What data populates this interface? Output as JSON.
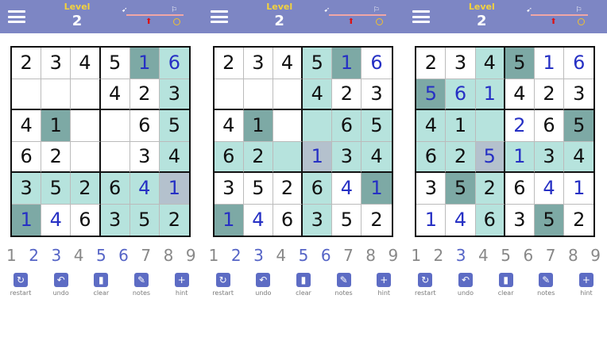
{
  "header": {
    "level_label": "Level",
    "level_value": "2",
    "progress_start_icon": "rocket-start-icon",
    "progress_end_icon": "finish-flag-icon",
    "progress_marker_icon": "arrow-up-icon",
    "reward_icon": "coin-icon"
  },
  "colors": {
    "header_bg": "#7d86c4",
    "level_label": "#f3d23d",
    "user_digit": "#2630c4",
    "highlight": "#b6e3dd",
    "selected_dark": "#7da9a5",
    "selected_gray": "#b4c1cd"
  },
  "numpad": [
    "1",
    "2",
    "3",
    "4",
    "5",
    "6",
    "7",
    "8",
    "9"
  ],
  "tools": [
    {
      "label": "restart",
      "icon": "restart-icon"
    },
    {
      "label": "undo",
      "icon": "undo-icon"
    },
    {
      "label": "clear",
      "icon": "trash-icon"
    },
    {
      "label": "notes",
      "icon": "pencil-icon"
    },
    {
      "label": "hint",
      "icon": "plus-icon"
    }
  ],
  "screens": [
    {
      "highlighted_digits": [
        "2",
        "3",
        "5",
        "6"
      ],
      "grid": [
        [
          [
            "2",
            "g",
            ""
          ],
          [
            "3",
            "g",
            ""
          ],
          [
            "4",
            "g",
            ""
          ],
          [
            "5",
            "g",
            ""
          ],
          [
            "1",
            "u",
            "d"
          ],
          [
            "6",
            "u",
            "h"
          ]
        ],
        [
          [
            "",
            "g",
            ""
          ],
          [
            "",
            "g",
            ""
          ],
          [
            "",
            "g",
            ""
          ],
          [
            "4",
            "g",
            ""
          ],
          [
            "2",
            "g",
            ""
          ],
          [
            "3",
            "g",
            "h"
          ]
        ],
        [
          [
            "4",
            "g",
            ""
          ],
          [
            "1",
            "g",
            "d"
          ],
          [
            "",
            "g",
            ""
          ],
          [
            "",
            "g",
            ""
          ],
          [
            "6",
            "g",
            ""
          ],
          [
            "5",
            "g",
            "h"
          ]
        ],
        [
          [
            "6",
            "g",
            ""
          ],
          [
            "2",
            "g",
            ""
          ],
          [
            "",
            "g",
            ""
          ],
          [
            "",
            "g",
            ""
          ],
          [
            "3",
            "g",
            ""
          ],
          [
            "4",
            "g",
            "h"
          ]
        ],
        [
          [
            "3",
            "g",
            "h"
          ],
          [
            "5",
            "g",
            "h"
          ],
          [
            "2",
            "g",
            "h"
          ],
          [
            "6",
            "g",
            "h"
          ],
          [
            "4",
            "u",
            "h"
          ],
          [
            "1",
            "u",
            "s"
          ]
        ],
        [
          [
            "1",
            "u",
            "d"
          ],
          [
            "4",
            "u",
            ""
          ],
          [
            "6",
            "g",
            ""
          ],
          [
            "3",
            "g",
            "h"
          ],
          [
            "5",
            "g",
            "h"
          ],
          [
            "2",
            "g",
            "h"
          ]
        ]
      ]
    },
    {
      "highlighted_digits": [
        "2",
        "3",
        "5",
        "6"
      ],
      "grid": [
        [
          [
            "2",
            "g",
            ""
          ],
          [
            "3",
            "g",
            ""
          ],
          [
            "4",
            "g",
            ""
          ],
          [
            "5",
            "g",
            "h"
          ],
          [
            "1",
            "u",
            "d"
          ],
          [
            "6",
            "u",
            ""
          ]
        ],
        [
          [
            "",
            "g",
            ""
          ],
          [
            "",
            "g",
            ""
          ],
          [
            "",
            "g",
            ""
          ],
          [
            "4",
            "g",
            "h"
          ],
          [
            "2",
            "g",
            ""
          ],
          [
            "3",
            "g",
            ""
          ]
        ],
        [
          [
            "4",
            "g",
            ""
          ],
          [
            "1",
            "g",
            "d"
          ],
          [
            "",
            "g",
            ""
          ],
          [
            "",
            "g",
            "h"
          ],
          [
            "6",
            "g",
            "h"
          ],
          [
            "5",
            "g",
            "h"
          ]
        ],
        [
          [
            "6",
            "g",
            "h"
          ],
          [
            "2",
            "g",
            "h"
          ],
          [
            "",
            "g",
            "h"
          ],
          [
            "1",
            "u",
            "s"
          ],
          [
            "3",
            "g",
            "h"
          ],
          [
            "4",
            "g",
            "h"
          ]
        ],
        [
          [
            "3",
            "g",
            ""
          ],
          [
            "5",
            "g",
            ""
          ],
          [
            "2",
            "g",
            ""
          ],
          [
            "6",
            "g",
            "h"
          ],
          [
            "4",
            "u",
            ""
          ],
          [
            "1",
            "u",
            "d"
          ]
        ],
        [
          [
            "1",
            "u",
            "d"
          ],
          [
            "4",
            "u",
            ""
          ],
          [
            "6",
            "g",
            ""
          ],
          [
            "3",
            "g",
            "h"
          ],
          [
            "5",
            "g",
            ""
          ],
          [
            "2",
            "g",
            ""
          ]
        ]
      ]
    },
    {
      "highlighted_digits": [
        "3"
      ],
      "grid": [
        [
          [
            "2",
            "g",
            ""
          ],
          [
            "3",
            "g",
            ""
          ],
          [
            "4",
            "g",
            "h"
          ],
          [
            "5",
            "g",
            "d"
          ],
          [
            "1",
            "u",
            ""
          ],
          [
            "6",
            "u",
            ""
          ]
        ],
        [
          [
            "5",
            "u",
            "d"
          ],
          [
            "6",
            "u",
            "h"
          ],
          [
            "1",
            "u",
            "h"
          ],
          [
            "4",
            "g",
            ""
          ],
          [
            "2",
            "g",
            ""
          ],
          [
            "3",
            "g",
            ""
          ]
        ],
        [
          [
            "4",
            "g",
            "h"
          ],
          [
            "1",
            "g",
            "h"
          ],
          [
            "",
            "g",
            "h"
          ],
          [
            "2",
            "u",
            ""
          ],
          [
            "6",
            "g",
            ""
          ],
          [
            "5",
            "g",
            "d"
          ]
        ],
        [
          [
            "6",
            "g",
            "h"
          ],
          [
            "2",
            "g",
            "h"
          ],
          [
            "5",
            "u",
            "s"
          ],
          [
            "1",
            "u",
            "h"
          ],
          [
            "3",
            "g",
            "h"
          ],
          [
            "4",
            "g",
            "h"
          ]
        ],
        [
          [
            "3",
            "g",
            ""
          ],
          [
            "5",
            "g",
            "d"
          ],
          [
            "2",
            "g",
            "h"
          ],
          [
            "6",
            "g",
            ""
          ],
          [
            "4",
            "u",
            ""
          ],
          [
            "1",
            "u",
            ""
          ]
        ],
        [
          [
            "1",
            "u",
            ""
          ],
          [
            "4",
            "u",
            ""
          ],
          [
            "6",
            "g",
            "h"
          ],
          [
            "3",
            "g",
            ""
          ],
          [
            "5",
            "g",
            "d"
          ],
          [
            "2",
            "g",
            ""
          ]
        ]
      ]
    }
  ]
}
